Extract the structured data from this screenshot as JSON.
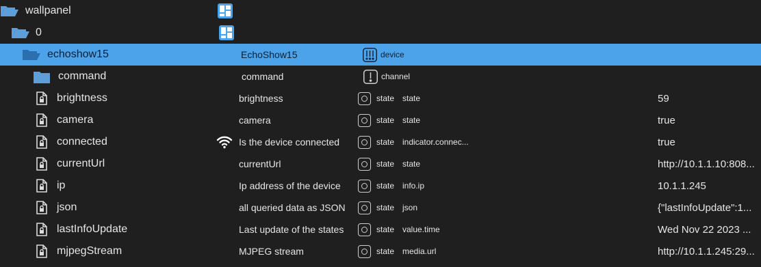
{
  "colors": {
    "background": "#1f1f1f",
    "selection": "#4ca3ea",
    "folder": "#5f9fd9",
    "text": "#e6e6e6"
  },
  "rows": [
    {
      "name": "wallpanel",
      "label": "",
      "role_icon": "layout-icon",
      "role": "",
      "type": "",
      "value": ""
    },
    {
      "name": "0",
      "label": "",
      "role_icon": "layout-icon",
      "role": "",
      "type": "",
      "value": ""
    },
    {
      "name": "echoshow15",
      "label": "EchoShow15",
      "role_icon": "device-icon",
      "role": "device",
      "type": "",
      "value": "",
      "selected": true
    },
    {
      "name": "command",
      "label": "command",
      "role_icon": "channel-icon",
      "role": "channel",
      "type": "",
      "value": ""
    },
    {
      "name": "brightness",
      "label": "brightness",
      "role_icon": "state-icon",
      "role": "state",
      "type": "state",
      "value": "59"
    },
    {
      "name": "camera",
      "label": "camera",
      "role_icon": "state-icon",
      "role": "state",
      "type": "state",
      "value": "true"
    },
    {
      "name": "connected",
      "label": "Is the device connected",
      "role_icon": "state-icon",
      "role": "state",
      "type": "indicator.connec...",
      "value": "true",
      "wifi": true
    },
    {
      "name": "currentUrl",
      "label": "currentUrl",
      "role_icon": "state-icon",
      "role": "state",
      "type": "state",
      "value": "http://10.1.1.10:808..."
    },
    {
      "name": "ip",
      "label": "Ip address of the device",
      "role_icon": "state-icon",
      "role": "state",
      "type": "info.ip",
      "value": "10.1.1.245"
    },
    {
      "name": "json",
      "label": "all queried data as JSON",
      "role_icon": "state-icon",
      "role": "state",
      "type": "json",
      "value": "{\"lastInfoUpdate\":1..."
    },
    {
      "name": "lastInfoUpdate",
      "label": "Last update of the states",
      "role_icon": "state-icon",
      "role": "state",
      "type": "value.time",
      "value": "Wed Nov 22 2023 ..."
    },
    {
      "name": "mjpegStream",
      "label": "MJPEG stream",
      "role_icon": "state-icon",
      "role": "state",
      "type": "media.url",
      "value": "http://10.1.1.245:29..."
    }
  ]
}
